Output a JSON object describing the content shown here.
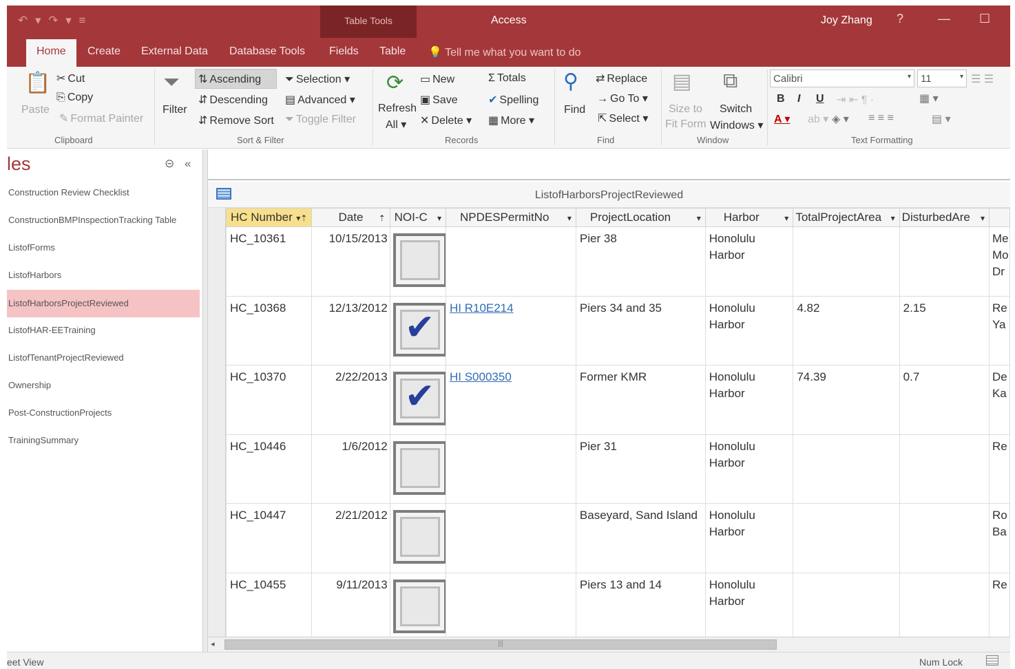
{
  "title_bar": {
    "undo_redo_glyphs": "↶ ▾  ↷ ▾  ≡",
    "context_tab_group": "Table Tools",
    "app_name": "Access",
    "user": "Joy Zhang",
    "help": "?",
    "minimize": "—",
    "maximize": "☐"
  },
  "tabs": [
    "Home",
    "Create",
    "External Data",
    "Database Tools",
    "Fields",
    "Table"
  ],
  "tell_me": "Tell me what you want to do",
  "ribbon": {
    "clipboard": {
      "paste": "Paste",
      "cut": "Cut",
      "copy": "Copy",
      "format_painter": "Format Painter",
      "label": "Clipboard"
    },
    "sort_filter": {
      "filter": "Filter",
      "ascending": "Ascending",
      "descending": "Descending",
      "remove_sort": "Remove Sort",
      "selection": "Selection ▾",
      "advanced": "Advanced ▾",
      "toggle_filter": "Toggle Filter",
      "label": "Sort & Filter"
    },
    "records": {
      "refresh": "Refresh",
      "refresh_all": "All ▾",
      "new": "New",
      "save": "Save",
      "delete": "Delete",
      "totals": "Totals",
      "spelling": "Spelling",
      "more": "More ▾",
      "label": "Records"
    },
    "find": {
      "find": "Find",
      "replace": "Replace",
      "goto": "Go To ▾",
      "select": "Select ▾",
      "label": "Find"
    },
    "window": {
      "size_to": "Size to",
      "fit_form": "Fit Form",
      "switch": "Switch",
      "windows": "Windows ▾",
      "label": "Window"
    },
    "text_formatting": {
      "font": "Calibri",
      "size": "11",
      "label": "Text Formatting"
    }
  },
  "nav": {
    "title": "les",
    "items": [
      "Construction Review Checklist",
      "ConstructionBMPInspectionTracking Table",
      "ListofForms",
      "ListofHarbors",
      "ListofHarborsProjectReviewed",
      "ListofHAR-EETraining",
      "ListofTenantProjectReviewed",
      "Ownership",
      "Post-ConstructionProjects",
      "TrainingSummary"
    ],
    "selected_index": 4
  },
  "table": {
    "name": "ListofHarborsProjectReviewed",
    "columns": [
      "HC Number",
      "Date",
      "NOI-C",
      "NPDESPermitNo",
      "ProjectLocation",
      "Harbor",
      "TotalProjectAreа",
      "DisturbedAre",
      ""
    ],
    "rows": [
      {
        "hc": "HC_10361",
        "date": "10/15/2013",
        "noi": false,
        "permit": "",
        "location": "Pier 38",
        "harbor": "Honolulu\nHarbor",
        "total": "",
        "disturbed": "",
        "extra": "Me\nMo\nDr"
      },
      {
        "hc": "HC_10368",
        "date": "12/13/2012",
        "noi": true,
        "permit": "HI R10E214",
        "location": "Piers 34 and 35",
        "harbor": "Honolulu\nHarbor",
        "total": "4.82",
        "disturbed": "2.15",
        "extra": "Re\nYa"
      },
      {
        "hc": "HC_10370",
        "date": "2/22/2013",
        "noi": true,
        "permit": "HI S000350",
        "location": "Former KMR",
        "harbor": "Honolulu\nHarbor",
        "total": "74.39",
        "disturbed": "0.7",
        "extra": "De\nKa"
      },
      {
        "hc": "HC_10446",
        "date": "1/6/2012",
        "noi": false,
        "permit": "",
        "location": "Pier 31",
        "harbor": "Honolulu\nHarbor",
        "total": "",
        "disturbed": "",
        "extra": "Re"
      },
      {
        "hc": "HC_10447",
        "date": "2/21/2012",
        "noi": false,
        "permit": "",
        "location": "Baseyard, Sand Island",
        "harbor": "Honolulu\nHarbor",
        "total": "",
        "disturbed": "",
        "extra": "Ro\nBa"
      },
      {
        "hc": "HC_10455",
        "date": "9/11/2013",
        "noi": false,
        "permit": "",
        "location": "Piers 13 and 14",
        "harbor": "Honolulu\nHarbor",
        "total": "",
        "disturbed": "",
        "extra": "Re"
      }
    ]
  },
  "status": {
    "view": "eet View",
    "num_lock": "Num Lock"
  }
}
